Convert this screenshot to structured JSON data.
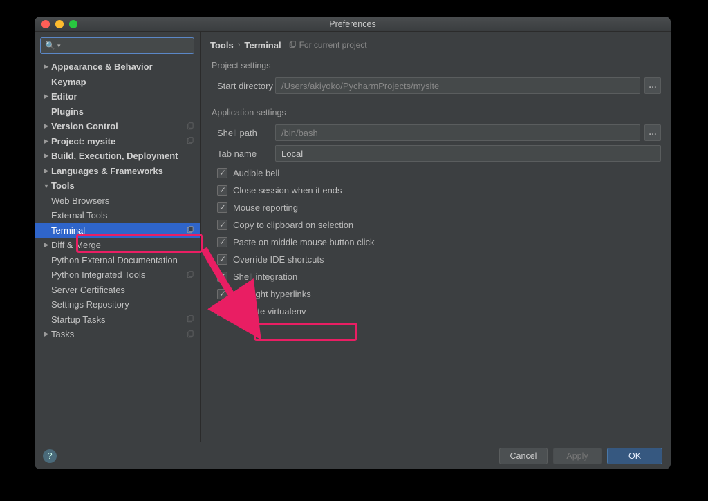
{
  "window": {
    "title": "Preferences"
  },
  "search": {
    "placeholder": ""
  },
  "breadcrumbs": {
    "root": "Tools",
    "leaf": "Terminal",
    "scope": "For current project"
  },
  "sidebar": {
    "items": [
      {
        "label": "Appearance & Behavior",
        "expandable": true,
        "top": true
      },
      {
        "label": "Keymap",
        "top": true
      },
      {
        "label": "Editor",
        "expandable": true,
        "top": true
      },
      {
        "label": "Plugins",
        "top": true
      },
      {
        "label": "Version Control",
        "expandable": true,
        "top": true,
        "copyable": true
      },
      {
        "label": "Project: mysite",
        "expandable": true,
        "top": true,
        "copyable": true
      },
      {
        "label": "Build, Execution, Deployment",
        "expandable": true,
        "top": true
      },
      {
        "label": "Languages & Frameworks",
        "expandable": true,
        "top": true
      },
      {
        "label": "Tools",
        "expandable": true,
        "top": true,
        "expanded": true
      },
      {
        "label": "Web Browsers",
        "depth": 1
      },
      {
        "label": "External Tools",
        "depth": 1
      },
      {
        "label": "Terminal",
        "depth": 1,
        "selected": true,
        "copyable": true
      },
      {
        "label": "Diff & Merge",
        "depth": 1,
        "expandable": true
      },
      {
        "label": "Python External Documentation",
        "depth": 1
      },
      {
        "label": "Python Integrated Tools",
        "depth": 1,
        "copyable": true
      },
      {
        "label": "Server Certificates",
        "depth": 1
      },
      {
        "label": "Settings Repository",
        "depth": 1
      },
      {
        "label": "Startup Tasks",
        "depth": 1,
        "copyable": true
      },
      {
        "label": "Tasks",
        "depth": 1,
        "expandable": true,
        "copyable": true
      }
    ]
  },
  "project_settings": {
    "title": "Project settings",
    "start_directory_label": "Start directory",
    "start_directory_value": "/Users/akiyoko/PycharmProjects/mysite"
  },
  "app_settings": {
    "title": "Application settings",
    "shell_path_label": "Shell path",
    "shell_path_value": "/bin/bash",
    "tab_name_label": "Tab name",
    "tab_name_value": "Local",
    "checks": [
      {
        "label": "Audible bell",
        "checked": true
      },
      {
        "label": "Close session when it ends",
        "checked": true
      },
      {
        "label": "Mouse reporting",
        "checked": true
      },
      {
        "label": "Copy to clipboard on selection",
        "checked": true
      },
      {
        "label": "Paste on middle mouse button click",
        "checked": true
      },
      {
        "label": "Override IDE shortcuts",
        "checked": true
      },
      {
        "label": "Shell integration",
        "checked": true
      },
      {
        "label": "Highlight hyperlinks",
        "checked": true
      },
      {
        "label": "Activate virtualenv",
        "checked": true
      }
    ]
  },
  "buttons": {
    "cancel": "Cancel",
    "apply": "Apply",
    "ok": "OK"
  },
  "annotation": {
    "arrow_color": "#e91e63"
  }
}
